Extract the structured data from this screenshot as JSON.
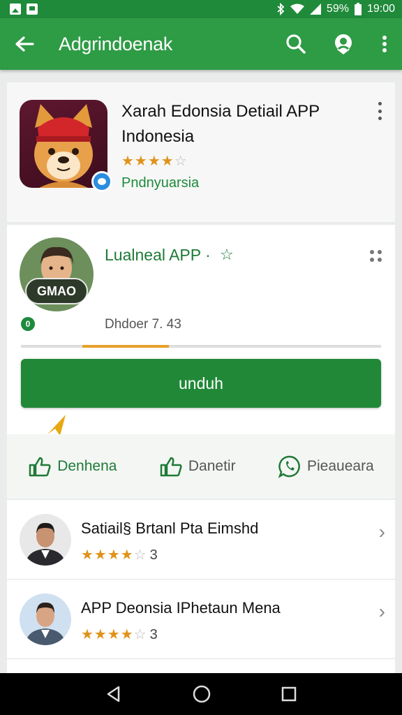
{
  "status_bar": {
    "battery": "59%",
    "time": "19:00",
    "icons": [
      "image-icon",
      "message-icon",
      "bluetooth-icon",
      "wifi-icon",
      "signal-icon",
      "battery-icon"
    ]
  },
  "app_bar": {
    "title": "Adgrindoenak",
    "icons": [
      "back-arrow-icon",
      "search-icon",
      "account-icon",
      "more-vert-icon"
    ]
  },
  "app_card": {
    "title": "Xarah Edonsia Detiail APP Indonesia",
    "rating_full": "★★★★",
    "rating_empty": "☆",
    "developer": "Pndnyuarsia"
  },
  "detail_card": {
    "title": "Lualneal APP ·",
    "star": "☆",
    "avatar_badge": "GMAO",
    "status_dot": "0",
    "info": "Dhdoer 7. 43",
    "progress": 0.24,
    "install_label": "unduh"
  },
  "actions": [
    {
      "label": "Denhena",
      "icon": "thumbs-up-icon"
    },
    {
      "label": "Danetir",
      "icon": "thumbs-up-outline-icon"
    },
    {
      "label": "Pieaueara",
      "icon": "whatsapp-icon"
    }
  ],
  "list": [
    {
      "title": "Satiail§ Brtanl Pta Eimshd",
      "rating_full": "★★★★",
      "rating_empty": "☆",
      "count": "3"
    },
    {
      "title": "APP Deonsia IPhetaun Mena",
      "rating_full": "★★★★",
      "rating_empty": "☆",
      "count": "3"
    }
  ],
  "colors": {
    "status_bar": "#1f8a3a",
    "app_bar": "#2e9b45",
    "primary_button": "#218838",
    "accent_text": "#1f7a36",
    "star": "#e0921a",
    "progress": "#e8a12b"
  }
}
